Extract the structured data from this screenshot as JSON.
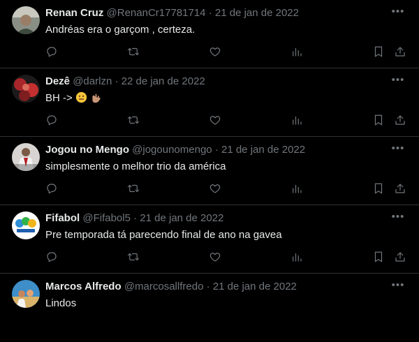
{
  "tweets": [
    {
      "name": "Renan Cruz",
      "handle": "@RenanCr17781714",
      "date": "21 de jan de 2022",
      "text": "Andréas era o garçom , certeza."
    },
    {
      "name": "Dezê",
      "handle": "@darlzn",
      "date": "22 de jan de 2022",
      "text": "BH ->"
    },
    {
      "name": "Jogou no Mengo",
      "handle": "@jogounomengo",
      "date": "21 de jan de 2022",
      "text": "simplesmente o melhor trio da américa"
    },
    {
      "name": "Fifabol",
      "handle": "@Fifabol5",
      "date": "21 de jan de 2022",
      "text": "Pre temporada tá parecendo final de ano na gavea"
    },
    {
      "name": "Marcos Alfredo",
      "handle": "@marcosallfredo",
      "date": "21 de jan de 2022",
      "text": "Lindos"
    }
  ],
  "separator": "·",
  "colors": {
    "background": "#000000",
    "text": "#e7e9ea",
    "muted": "#71767b",
    "divider": "#2f3336"
  },
  "icons": {
    "more": "more-horizontal-icon",
    "reply": "reply-icon",
    "retweet": "retweet-icon",
    "like": "like-icon",
    "views": "views-icon",
    "bookmark": "bookmark-icon",
    "share": "share-icon"
  }
}
